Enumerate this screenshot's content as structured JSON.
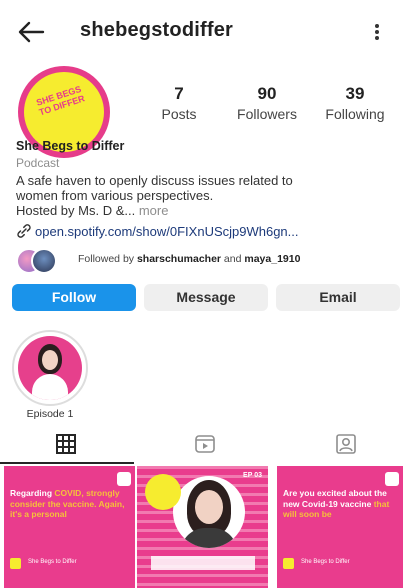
{
  "header": {
    "username": "shebegstodiffer",
    "back_icon": "arrow-left-icon",
    "menu_icon": "more-vertical-icon"
  },
  "profile": {
    "posts_count": "7",
    "posts_label": "Posts",
    "followers_count": "90",
    "followers_label": "Followers",
    "following_count": "39",
    "following_label": "Following",
    "name": "She Begs to Differ",
    "category": "Podcast",
    "bio_line1": "A safe haven to openly discuss issues related to",
    "bio_line2": "women from various perspectives.",
    "bio_line3": "Hosted by Ms. D &...",
    "more_label": "more",
    "link": "open.spotify.com/show/0FIXnUScjp9Wh6gn...",
    "followed_prefix": "Followed by",
    "followed_user1": "sharschumacher",
    "followed_and": "and",
    "followed_user2": "maya_1910"
  },
  "buttons": {
    "follow": "Follow",
    "message": "Message",
    "email": "Email"
  },
  "highlights": [
    {
      "label": "Episode 1"
    }
  ],
  "tabs": {
    "grid_icon": "grid-icon",
    "reels_icon": "reels-icon",
    "tagged_icon": "tagged-icon"
  },
  "posts": [
    {
      "text_a": "Regarding",
      "text_hl": "COVID,",
      "text_b": "strongly consider the vaccine. Again, it's a personal",
      "footer": "She Begs to Differ"
    },
    {
      "ep": "EP 03"
    },
    {
      "text_a": "Are you excited about the new Covid-19 vaccine",
      "text_hl": "that will soon be",
      "footer": "She Begs to Differ"
    }
  ],
  "colors": {
    "brand_pink": "#e93c8d",
    "brand_yellow": "#f6ec2f",
    "follow_blue": "#1a93ea"
  }
}
